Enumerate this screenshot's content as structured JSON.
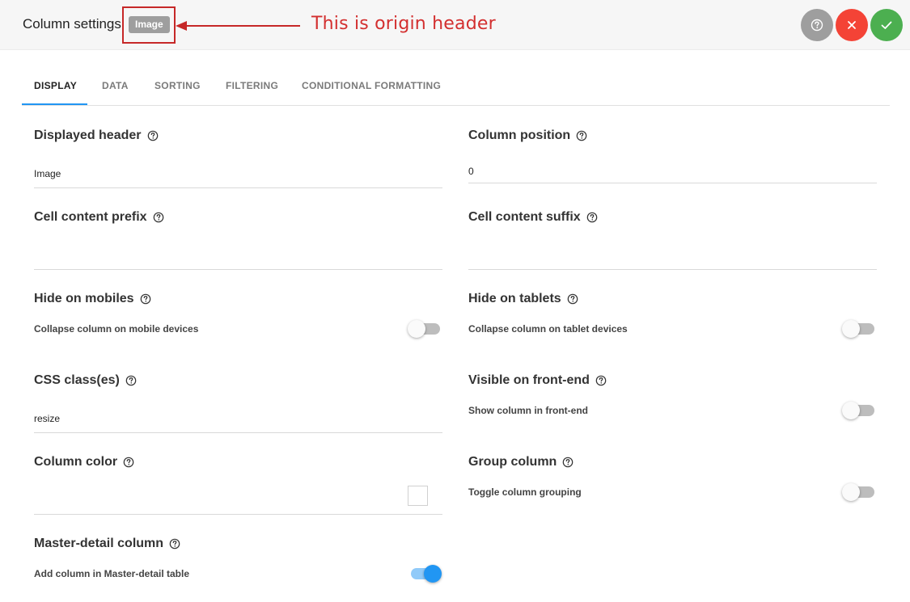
{
  "header": {
    "title": "Column settings",
    "origin_badge": "Image",
    "annotation": "This is origin header",
    "buttons": {
      "help_icon": "help-circle-icon",
      "cancel_icon": "close-icon",
      "save_icon": "check-icon"
    },
    "colors": {
      "help": "#9e9e9e",
      "cancel": "#f44336",
      "save": "#4caf50",
      "annotation": "#d32f2f"
    }
  },
  "tabs": [
    {
      "label": "DISPLAY",
      "active": true
    },
    {
      "label": "DATA",
      "active": false
    },
    {
      "label": "SORTING",
      "active": false
    },
    {
      "label": "FILTERING",
      "active": false
    },
    {
      "label": "CONDITIONAL FORMATTING",
      "active": false
    }
  ],
  "fields": {
    "displayed_header": {
      "label": "Displayed header",
      "value": "Image"
    },
    "column_position": {
      "label": "Column position",
      "value": "0"
    },
    "cell_prefix": {
      "label": "Cell content prefix",
      "value": ""
    },
    "cell_suffix": {
      "label": "Cell content suffix",
      "value": ""
    },
    "hide_mobiles": {
      "label": "Hide on mobiles",
      "description": "Collapse column on mobile devices",
      "enabled": false
    },
    "hide_tablets": {
      "label": "Hide on tablets",
      "description": "Collapse column on tablet devices",
      "enabled": false
    },
    "css_classes": {
      "label": "CSS class(es)",
      "value": "resize"
    },
    "visible_frontend": {
      "label": "Visible on front-end",
      "description": "Show column in front-end",
      "enabled": false
    },
    "column_color": {
      "label": "Column color",
      "value": "#ffffff"
    },
    "group_column": {
      "label": "Group column",
      "description": "Toggle column grouping",
      "enabled": false
    },
    "master_detail": {
      "label": "Master-detail column",
      "description": "Add column in Master-detail table",
      "enabled": true
    }
  },
  "accent_color": "#2196f3"
}
